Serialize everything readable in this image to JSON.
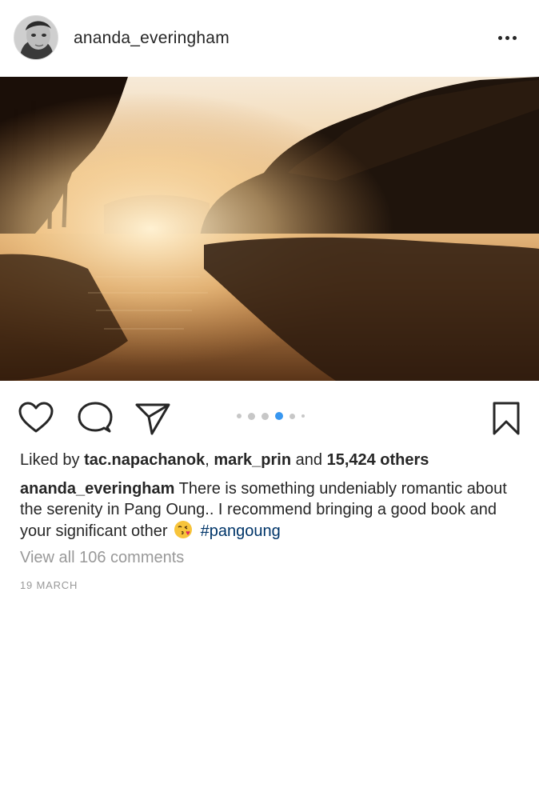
{
  "post": {
    "username": "ananda_everingham",
    "more_icon": "more-horizontal-icon",
    "photo_description_icon": "photo",
    "carousel": {
      "total": 6,
      "current_index": 3
    },
    "likes": {
      "prefix": "Liked by",
      "user1": "tac.napachanok",
      "separator": ",",
      "user2": "mark_prin",
      "and": "and",
      "count": "15,424 others"
    },
    "caption": {
      "username": "ananda_everingham",
      "text": "There is something undeniably romantic about the serenity in Pang Oung.. I recommend bringing a good book and your significant other",
      "emoji": "face-blowing-kiss-icon",
      "hashtag": "#pangoung"
    },
    "view_comments": "View all 106 comments",
    "date": "19 MARCH"
  },
  "colors": {
    "text": "#262626",
    "muted": "#999999",
    "hashtag": "#003569",
    "carousel_active": "#3897f0",
    "carousel_inactive": "#c7c7c7"
  }
}
